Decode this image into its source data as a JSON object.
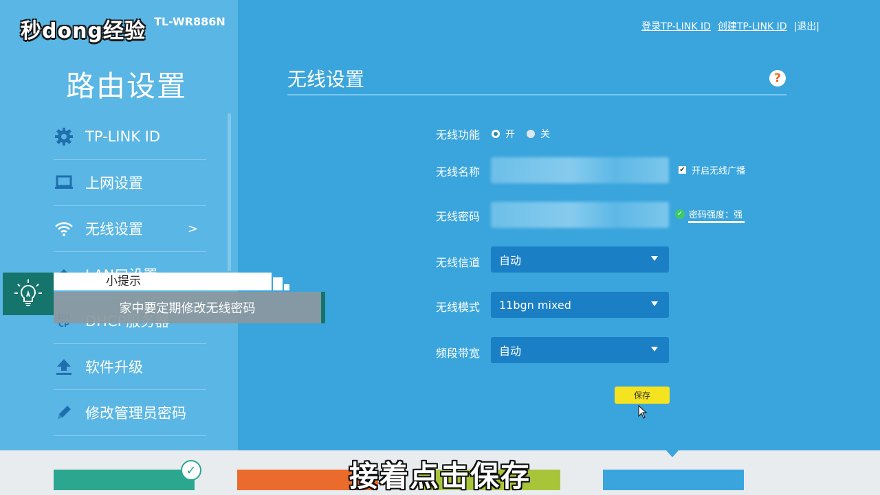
{
  "watermark": {
    "logo_text": "秒dong经验"
  },
  "router": {
    "model": "TL-WR886N"
  },
  "sidebar": {
    "title": "路由设置",
    "items": [
      {
        "label": "TP-LINK ID",
        "icon": "gear-icon"
      },
      {
        "label": "上网设置",
        "icon": "laptop-icon"
      },
      {
        "label": "无线设置",
        "icon": "wifi-icon",
        "active": true,
        "chevron": ">"
      },
      {
        "label": "LAN口设置",
        "icon": "lan-icon"
      },
      {
        "label": "DHCP服务器",
        "icon": "dhcp-icon",
        "icon_text": "DH CP"
      },
      {
        "label": "软件升级",
        "icon": "upload-icon"
      },
      {
        "label": "修改管理员密码",
        "icon": "pencil-icon"
      }
    ]
  },
  "header": {
    "links": [
      "登录TP-LINK ID",
      "创建TP-LINK ID",
      "|退出|"
    ]
  },
  "main": {
    "title": "无线设置",
    "help_symbol": "?",
    "form": {
      "wireless_function": {
        "label": "无线功能",
        "options": [
          "开",
          "关"
        ],
        "selected": "开"
      },
      "ssid": {
        "label": "无线名称",
        "value": ""
      },
      "broadcast": {
        "label": "开启无线广播",
        "checked": true
      },
      "password": {
        "label": "无线密码",
        "value": ""
      },
      "password_strength": "密码强度：强",
      "channel": {
        "label": "无线信道",
        "value": "自动"
      },
      "mode": {
        "label": "无线模式",
        "value": "11bgn mixed"
      },
      "bandwidth": {
        "label": "频段带宽",
        "value": "自动"
      }
    },
    "save_label": "保存"
  },
  "tip": {
    "heading": "小提示",
    "text": "家中要定期修改无线密码"
  },
  "subtitle": "接着点击保存",
  "colors": {
    "sidebar_bg": "#5ab6e4",
    "main_bg": "#3aa5dc",
    "select_bg": "#1a7fc4",
    "save_bg": "#f6e31f",
    "tip_green": "#15746b",
    "tile_teal": "#2aa78e",
    "tile_orange": "#ea6b2c",
    "tile_lime": "#a8c53a",
    "tile_blue": "#3aa5dc"
  }
}
